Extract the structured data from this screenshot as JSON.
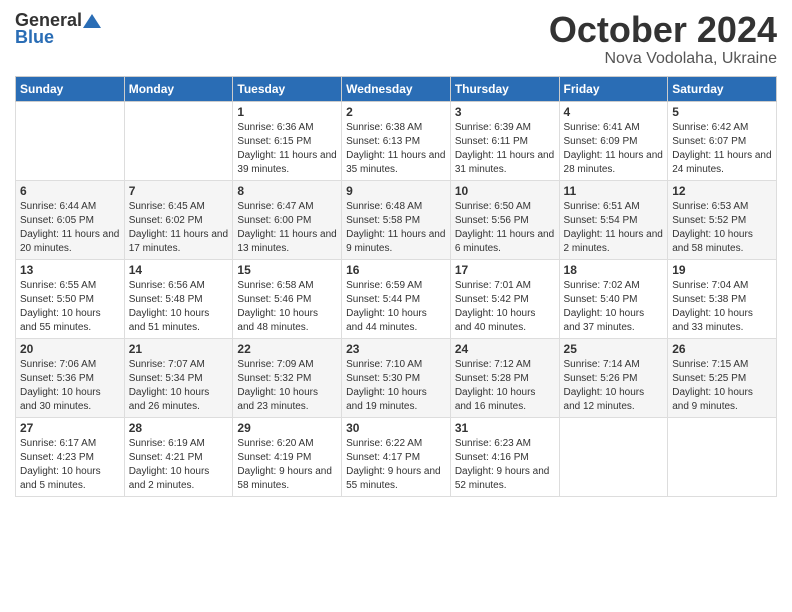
{
  "logo": {
    "general": "General",
    "blue": "Blue"
  },
  "title": {
    "month": "October 2024",
    "location": "Nova Vodolaha, Ukraine"
  },
  "headers": [
    "Sunday",
    "Monday",
    "Tuesday",
    "Wednesday",
    "Thursday",
    "Friday",
    "Saturday"
  ],
  "weeks": [
    [
      {
        "day": "",
        "sunrise": "",
        "sunset": "",
        "daylight": ""
      },
      {
        "day": "",
        "sunrise": "",
        "sunset": "",
        "daylight": ""
      },
      {
        "day": "1",
        "sunrise": "Sunrise: 6:36 AM",
        "sunset": "Sunset: 6:15 PM",
        "daylight": "Daylight: 11 hours and 39 minutes."
      },
      {
        "day": "2",
        "sunrise": "Sunrise: 6:38 AM",
        "sunset": "Sunset: 6:13 PM",
        "daylight": "Daylight: 11 hours and 35 minutes."
      },
      {
        "day": "3",
        "sunrise": "Sunrise: 6:39 AM",
        "sunset": "Sunset: 6:11 PM",
        "daylight": "Daylight: 11 hours and 31 minutes."
      },
      {
        "day": "4",
        "sunrise": "Sunrise: 6:41 AM",
        "sunset": "Sunset: 6:09 PM",
        "daylight": "Daylight: 11 hours and 28 minutes."
      },
      {
        "day": "5",
        "sunrise": "Sunrise: 6:42 AM",
        "sunset": "Sunset: 6:07 PM",
        "daylight": "Daylight: 11 hours and 24 minutes."
      }
    ],
    [
      {
        "day": "6",
        "sunrise": "Sunrise: 6:44 AM",
        "sunset": "Sunset: 6:05 PM",
        "daylight": "Daylight: 11 hours and 20 minutes."
      },
      {
        "day": "7",
        "sunrise": "Sunrise: 6:45 AM",
        "sunset": "Sunset: 6:02 PM",
        "daylight": "Daylight: 11 hours and 17 minutes."
      },
      {
        "day": "8",
        "sunrise": "Sunrise: 6:47 AM",
        "sunset": "Sunset: 6:00 PM",
        "daylight": "Daylight: 11 hours and 13 minutes."
      },
      {
        "day": "9",
        "sunrise": "Sunrise: 6:48 AM",
        "sunset": "Sunset: 5:58 PM",
        "daylight": "Daylight: 11 hours and 9 minutes."
      },
      {
        "day": "10",
        "sunrise": "Sunrise: 6:50 AM",
        "sunset": "Sunset: 5:56 PM",
        "daylight": "Daylight: 11 hours and 6 minutes."
      },
      {
        "day": "11",
        "sunrise": "Sunrise: 6:51 AM",
        "sunset": "Sunset: 5:54 PM",
        "daylight": "Daylight: 11 hours and 2 minutes."
      },
      {
        "day": "12",
        "sunrise": "Sunrise: 6:53 AM",
        "sunset": "Sunset: 5:52 PM",
        "daylight": "Daylight: 10 hours and 58 minutes."
      }
    ],
    [
      {
        "day": "13",
        "sunrise": "Sunrise: 6:55 AM",
        "sunset": "Sunset: 5:50 PM",
        "daylight": "Daylight: 10 hours and 55 minutes."
      },
      {
        "day": "14",
        "sunrise": "Sunrise: 6:56 AM",
        "sunset": "Sunset: 5:48 PM",
        "daylight": "Daylight: 10 hours and 51 minutes."
      },
      {
        "day": "15",
        "sunrise": "Sunrise: 6:58 AM",
        "sunset": "Sunset: 5:46 PM",
        "daylight": "Daylight: 10 hours and 48 minutes."
      },
      {
        "day": "16",
        "sunrise": "Sunrise: 6:59 AM",
        "sunset": "Sunset: 5:44 PM",
        "daylight": "Daylight: 10 hours and 44 minutes."
      },
      {
        "day": "17",
        "sunrise": "Sunrise: 7:01 AM",
        "sunset": "Sunset: 5:42 PM",
        "daylight": "Daylight: 10 hours and 40 minutes."
      },
      {
        "day": "18",
        "sunrise": "Sunrise: 7:02 AM",
        "sunset": "Sunset: 5:40 PM",
        "daylight": "Daylight: 10 hours and 37 minutes."
      },
      {
        "day": "19",
        "sunrise": "Sunrise: 7:04 AM",
        "sunset": "Sunset: 5:38 PM",
        "daylight": "Daylight: 10 hours and 33 minutes."
      }
    ],
    [
      {
        "day": "20",
        "sunrise": "Sunrise: 7:06 AM",
        "sunset": "Sunset: 5:36 PM",
        "daylight": "Daylight: 10 hours and 30 minutes."
      },
      {
        "day": "21",
        "sunrise": "Sunrise: 7:07 AM",
        "sunset": "Sunset: 5:34 PM",
        "daylight": "Daylight: 10 hours and 26 minutes."
      },
      {
        "day": "22",
        "sunrise": "Sunrise: 7:09 AM",
        "sunset": "Sunset: 5:32 PM",
        "daylight": "Daylight: 10 hours and 23 minutes."
      },
      {
        "day": "23",
        "sunrise": "Sunrise: 7:10 AM",
        "sunset": "Sunset: 5:30 PM",
        "daylight": "Daylight: 10 hours and 19 minutes."
      },
      {
        "day": "24",
        "sunrise": "Sunrise: 7:12 AM",
        "sunset": "Sunset: 5:28 PM",
        "daylight": "Daylight: 10 hours and 16 minutes."
      },
      {
        "day": "25",
        "sunrise": "Sunrise: 7:14 AM",
        "sunset": "Sunset: 5:26 PM",
        "daylight": "Daylight: 10 hours and 12 minutes."
      },
      {
        "day": "26",
        "sunrise": "Sunrise: 7:15 AM",
        "sunset": "Sunset: 5:25 PM",
        "daylight": "Daylight: 10 hours and 9 minutes."
      }
    ],
    [
      {
        "day": "27",
        "sunrise": "Sunrise: 6:17 AM",
        "sunset": "Sunset: 4:23 PM",
        "daylight": "Daylight: 10 hours and 5 minutes."
      },
      {
        "day": "28",
        "sunrise": "Sunrise: 6:19 AM",
        "sunset": "Sunset: 4:21 PM",
        "daylight": "Daylight: 10 hours and 2 minutes."
      },
      {
        "day": "29",
        "sunrise": "Sunrise: 6:20 AM",
        "sunset": "Sunset: 4:19 PM",
        "daylight": "Daylight: 9 hours and 58 minutes."
      },
      {
        "day": "30",
        "sunrise": "Sunrise: 6:22 AM",
        "sunset": "Sunset: 4:17 PM",
        "daylight": "Daylight: 9 hours and 55 minutes."
      },
      {
        "day": "31",
        "sunrise": "Sunrise: 6:23 AM",
        "sunset": "Sunset: 4:16 PM",
        "daylight": "Daylight: 9 hours and 52 minutes."
      },
      {
        "day": "",
        "sunrise": "",
        "sunset": "",
        "daylight": ""
      },
      {
        "day": "",
        "sunrise": "",
        "sunset": "",
        "daylight": ""
      }
    ]
  ]
}
